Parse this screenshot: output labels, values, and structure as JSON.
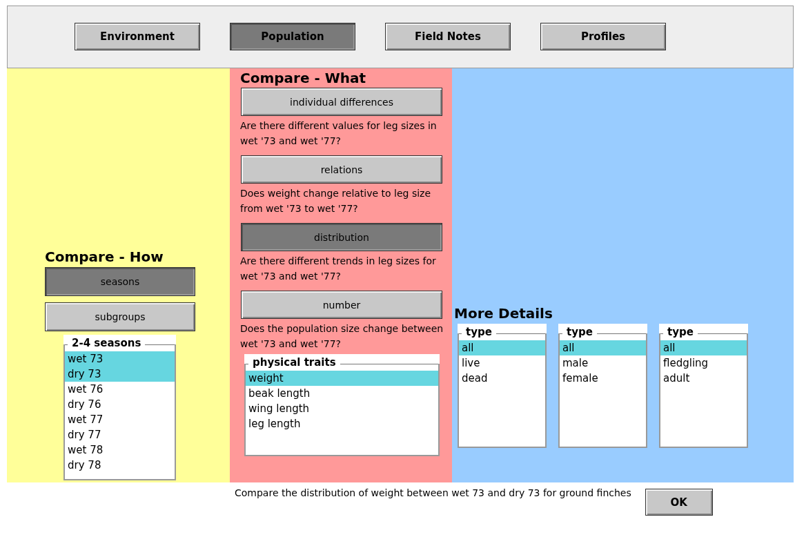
{
  "tabs": [
    {
      "label": "Environment",
      "selected": false
    },
    {
      "label": "Population",
      "selected": true
    },
    {
      "label": "Field Notes",
      "selected": false
    },
    {
      "label": "Profiles",
      "selected": false
    }
  ],
  "compare_how": {
    "title": "Compare - How",
    "buttons": [
      {
        "label": "seasons",
        "selected": true
      },
      {
        "label": "subgroups",
        "selected": false
      }
    ],
    "seasons_list": {
      "title": "2-4 seasons",
      "items": [
        {
          "label": "wet 73",
          "selected": true
        },
        {
          "label": "dry 73",
          "selected": true
        },
        {
          "label": "wet 76",
          "selected": false
        },
        {
          "label": "dry 76",
          "selected": false
        },
        {
          "label": "wet 77",
          "selected": false
        },
        {
          "label": "dry 77",
          "selected": false
        },
        {
          "label": "wet 78",
          "selected": false
        },
        {
          "label": "dry 78",
          "selected": false
        }
      ]
    }
  },
  "compare_what": {
    "title": "Compare - What",
    "options": [
      {
        "label": "individual differences",
        "selected": false,
        "question": "Are there different values for leg sizes in wet '73 and wet '77?"
      },
      {
        "label": "relations",
        "selected": false,
        "question": "Does weight change relative to leg size from wet '73 to wet '77?"
      },
      {
        "label": "distribution",
        "selected": true,
        "question": "Are there different trends in leg sizes for wet '73 and wet '77?"
      },
      {
        "label": "number",
        "selected": false,
        "question": "Does the population size change between wet '73 and wet '77?"
      }
    ],
    "traits_list": {
      "title": "physical traits",
      "items": [
        {
          "label": "weight",
          "selected": true
        },
        {
          "label": "beak length",
          "selected": false
        },
        {
          "label": "wing length",
          "selected": false
        },
        {
          "label": "leg length",
          "selected": false
        }
      ]
    }
  },
  "more_details": {
    "title": "More Details",
    "lists": [
      {
        "title": "type",
        "items": [
          {
            "label": "all",
            "selected": true
          },
          {
            "label": "live",
            "selected": false
          },
          {
            "label": "dead",
            "selected": false
          }
        ]
      },
      {
        "title": "type",
        "items": [
          {
            "label": "all",
            "selected": true
          },
          {
            "label": "male",
            "selected": false
          },
          {
            "label": "female",
            "selected": false
          }
        ]
      },
      {
        "title": "type",
        "items": [
          {
            "label": "all",
            "selected": true
          },
          {
            "label": "fledgling",
            "selected": false
          },
          {
            "label": "adult",
            "selected": false
          }
        ]
      }
    ]
  },
  "status_text": "Compare the distribution of weight between wet 73 and dry 73 for ground finches",
  "ok_button": "OK"
}
